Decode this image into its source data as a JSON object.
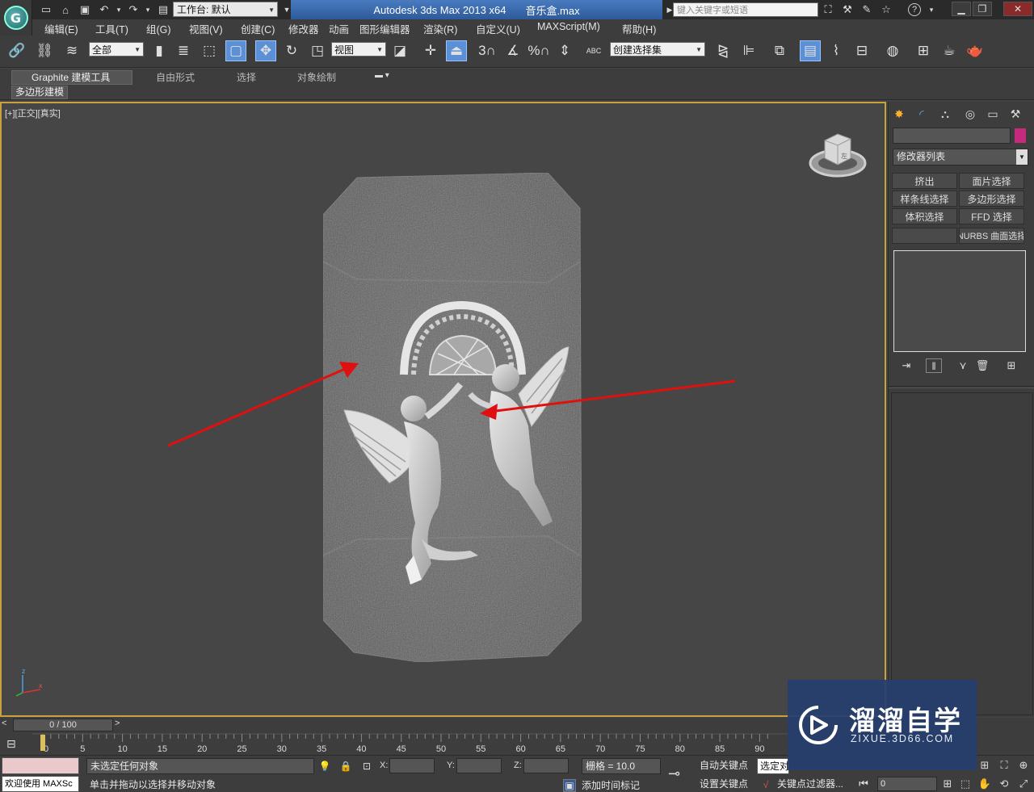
{
  "title_bar": {
    "app_title": "Autodesk 3ds Max  2013 x64",
    "file_name": "音乐盒.max",
    "workspace": "工作台: 默认",
    "search_placeholder": "键入关键字或短语",
    "help_glyph": "?",
    "quick_access_icons": [
      "new-icon",
      "open-icon",
      "save-icon",
      "undo-icon",
      "redo-icon",
      "project-icon"
    ]
  },
  "menu": [
    "编辑(E)",
    "工具(T)",
    "组(G)",
    "视图(V)",
    "创建(C)",
    "修改器",
    "动画",
    "图形编辑器",
    "渲染(R)",
    "自定义(U)",
    "MAXScript(M)",
    "帮助(H)"
  ],
  "toolbar": {
    "selection_filter": "全部",
    "ref_coord": "视图",
    "named_selection": "创建选择集",
    "snap_3": "3",
    "snap_percent": "%",
    "abc_label": "ABC"
  },
  "ribbon": {
    "tabs": [
      "Graphite 建模工具",
      "自由形式",
      "选择",
      "对象绘制"
    ],
    "sub_panel": "多边形建模"
  },
  "viewport": {
    "label": "[+][正交][真实]",
    "view_cube_face": "左",
    "axis_z": "z",
    "axis_x": "x",
    "border_color": "#c9a23a",
    "arrow_color": "#e01010"
  },
  "command_panel": {
    "modifier_list": "修改器列表",
    "object_color": "#c52a7f",
    "buttons": [
      "挤出",
      "面片选择",
      "样条线选择",
      "多边形选择",
      "体积选择",
      "FFD 选择",
      "",
      "NURBS 曲面选择"
    ]
  },
  "timeline": {
    "position": "0 / 100",
    "ticks": [
      "0",
      "5",
      "10",
      "15",
      "20",
      "25",
      "30",
      "35",
      "40",
      "45",
      "50",
      "55",
      "60",
      "65",
      "70",
      "75",
      "80",
      "85",
      "90"
    ]
  },
  "status": {
    "maxscript_text": "欢迎使用 MAXSc",
    "selection": "未选定任何对象",
    "prompt": "单击并拖动以选择并移动对象",
    "x_label": "X:",
    "y_label": "Y:",
    "z_label": "Z:",
    "grid": "栅格 = 10.0",
    "add_time_tag": "添加时间标记",
    "auto_key": "自动关键点",
    "selected_dd": "选定对",
    "set_key": "设置关键点",
    "key_filter": "关键点过滤器...",
    "frame": "0"
  },
  "watermark": {
    "title": "溜溜自学",
    "url": "ZIXUE.3D66.COM"
  }
}
